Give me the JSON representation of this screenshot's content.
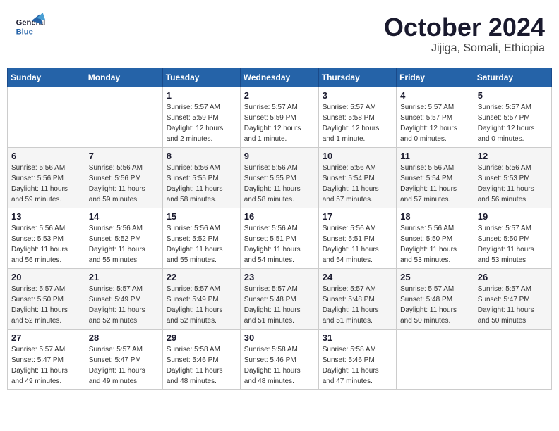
{
  "header": {
    "logo_line1": "General",
    "logo_line2": "Blue",
    "month": "October 2024",
    "location": "Jijiga, Somali, Ethiopia"
  },
  "weekdays": [
    "Sunday",
    "Monday",
    "Tuesday",
    "Wednesday",
    "Thursday",
    "Friday",
    "Saturday"
  ],
  "weeks": [
    [
      {
        "day": "",
        "info": ""
      },
      {
        "day": "",
        "info": ""
      },
      {
        "day": "1",
        "info": "Sunrise: 5:57 AM\nSunset: 5:59 PM\nDaylight: 12 hours\nand 2 minutes."
      },
      {
        "day": "2",
        "info": "Sunrise: 5:57 AM\nSunset: 5:59 PM\nDaylight: 12 hours\nand 1 minute."
      },
      {
        "day": "3",
        "info": "Sunrise: 5:57 AM\nSunset: 5:58 PM\nDaylight: 12 hours\nand 1 minute."
      },
      {
        "day": "4",
        "info": "Sunrise: 5:57 AM\nSunset: 5:57 PM\nDaylight: 12 hours\nand 0 minutes."
      },
      {
        "day": "5",
        "info": "Sunrise: 5:57 AM\nSunset: 5:57 PM\nDaylight: 12 hours\nand 0 minutes."
      }
    ],
    [
      {
        "day": "6",
        "info": "Sunrise: 5:56 AM\nSunset: 5:56 PM\nDaylight: 11 hours\nand 59 minutes."
      },
      {
        "day": "7",
        "info": "Sunrise: 5:56 AM\nSunset: 5:56 PM\nDaylight: 11 hours\nand 59 minutes."
      },
      {
        "day": "8",
        "info": "Sunrise: 5:56 AM\nSunset: 5:55 PM\nDaylight: 11 hours\nand 58 minutes."
      },
      {
        "day": "9",
        "info": "Sunrise: 5:56 AM\nSunset: 5:55 PM\nDaylight: 11 hours\nand 58 minutes."
      },
      {
        "day": "10",
        "info": "Sunrise: 5:56 AM\nSunset: 5:54 PM\nDaylight: 11 hours\nand 57 minutes."
      },
      {
        "day": "11",
        "info": "Sunrise: 5:56 AM\nSunset: 5:54 PM\nDaylight: 11 hours\nand 57 minutes."
      },
      {
        "day": "12",
        "info": "Sunrise: 5:56 AM\nSunset: 5:53 PM\nDaylight: 11 hours\nand 56 minutes."
      }
    ],
    [
      {
        "day": "13",
        "info": "Sunrise: 5:56 AM\nSunset: 5:53 PM\nDaylight: 11 hours\nand 56 minutes."
      },
      {
        "day": "14",
        "info": "Sunrise: 5:56 AM\nSunset: 5:52 PM\nDaylight: 11 hours\nand 55 minutes."
      },
      {
        "day": "15",
        "info": "Sunrise: 5:56 AM\nSunset: 5:52 PM\nDaylight: 11 hours\nand 55 minutes."
      },
      {
        "day": "16",
        "info": "Sunrise: 5:56 AM\nSunset: 5:51 PM\nDaylight: 11 hours\nand 54 minutes."
      },
      {
        "day": "17",
        "info": "Sunrise: 5:56 AM\nSunset: 5:51 PM\nDaylight: 11 hours\nand 54 minutes."
      },
      {
        "day": "18",
        "info": "Sunrise: 5:56 AM\nSunset: 5:50 PM\nDaylight: 11 hours\nand 53 minutes."
      },
      {
        "day": "19",
        "info": "Sunrise: 5:57 AM\nSunset: 5:50 PM\nDaylight: 11 hours\nand 53 minutes."
      }
    ],
    [
      {
        "day": "20",
        "info": "Sunrise: 5:57 AM\nSunset: 5:50 PM\nDaylight: 11 hours\nand 52 minutes."
      },
      {
        "day": "21",
        "info": "Sunrise: 5:57 AM\nSunset: 5:49 PM\nDaylight: 11 hours\nand 52 minutes."
      },
      {
        "day": "22",
        "info": "Sunrise: 5:57 AM\nSunset: 5:49 PM\nDaylight: 11 hours\nand 52 minutes."
      },
      {
        "day": "23",
        "info": "Sunrise: 5:57 AM\nSunset: 5:48 PM\nDaylight: 11 hours\nand 51 minutes."
      },
      {
        "day": "24",
        "info": "Sunrise: 5:57 AM\nSunset: 5:48 PM\nDaylight: 11 hours\nand 51 minutes."
      },
      {
        "day": "25",
        "info": "Sunrise: 5:57 AM\nSunset: 5:48 PM\nDaylight: 11 hours\nand 50 minutes."
      },
      {
        "day": "26",
        "info": "Sunrise: 5:57 AM\nSunset: 5:47 PM\nDaylight: 11 hours\nand 50 minutes."
      }
    ],
    [
      {
        "day": "27",
        "info": "Sunrise: 5:57 AM\nSunset: 5:47 PM\nDaylight: 11 hours\nand 49 minutes."
      },
      {
        "day": "28",
        "info": "Sunrise: 5:57 AM\nSunset: 5:47 PM\nDaylight: 11 hours\nand 49 minutes."
      },
      {
        "day": "29",
        "info": "Sunrise: 5:58 AM\nSunset: 5:46 PM\nDaylight: 11 hours\nand 48 minutes."
      },
      {
        "day": "30",
        "info": "Sunrise: 5:58 AM\nSunset: 5:46 PM\nDaylight: 11 hours\nand 48 minutes."
      },
      {
        "day": "31",
        "info": "Sunrise: 5:58 AM\nSunset: 5:46 PM\nDaylight: 11 hours\nand 47 minutes."
      },
      {
        "day": "",
        "info": ""
      },
      {
        "day": "",
        "info": ""
      }
    ]
  ]
}
